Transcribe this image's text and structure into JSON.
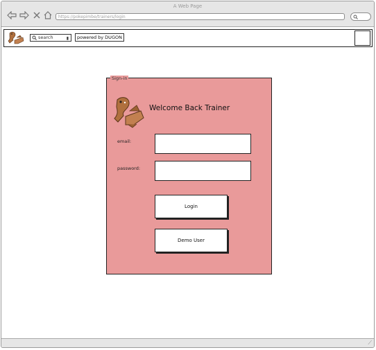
{
  "window": {
    "title": "A Web Page"
  },
  "browser": {
    "address": "https://pokepimbe/trainers/login",
    "icons": [
      "back-arrow-icon",
      "forward-arrow-icon",
      "close-x-icon",
      "home-icon",
      "search-icon"
    ]
  },
  "toolbar": {
    "search_placeholder": "search",
    "powered_by": "powered by DUGON"
  },
  "signin": {
    "legend": "Sign-in",
    "welcome": "Welcome Back Trainer",
    "email_label": "email:",
    "password_label": "password:",
    "login_button": "Login",
    "demo_button": "Demo User"
  },
  "colors": {
    "panel": "#e99a9a",
    "logo": "#b0703e",
    "chrome": "#e6e6e6"
  }
}
